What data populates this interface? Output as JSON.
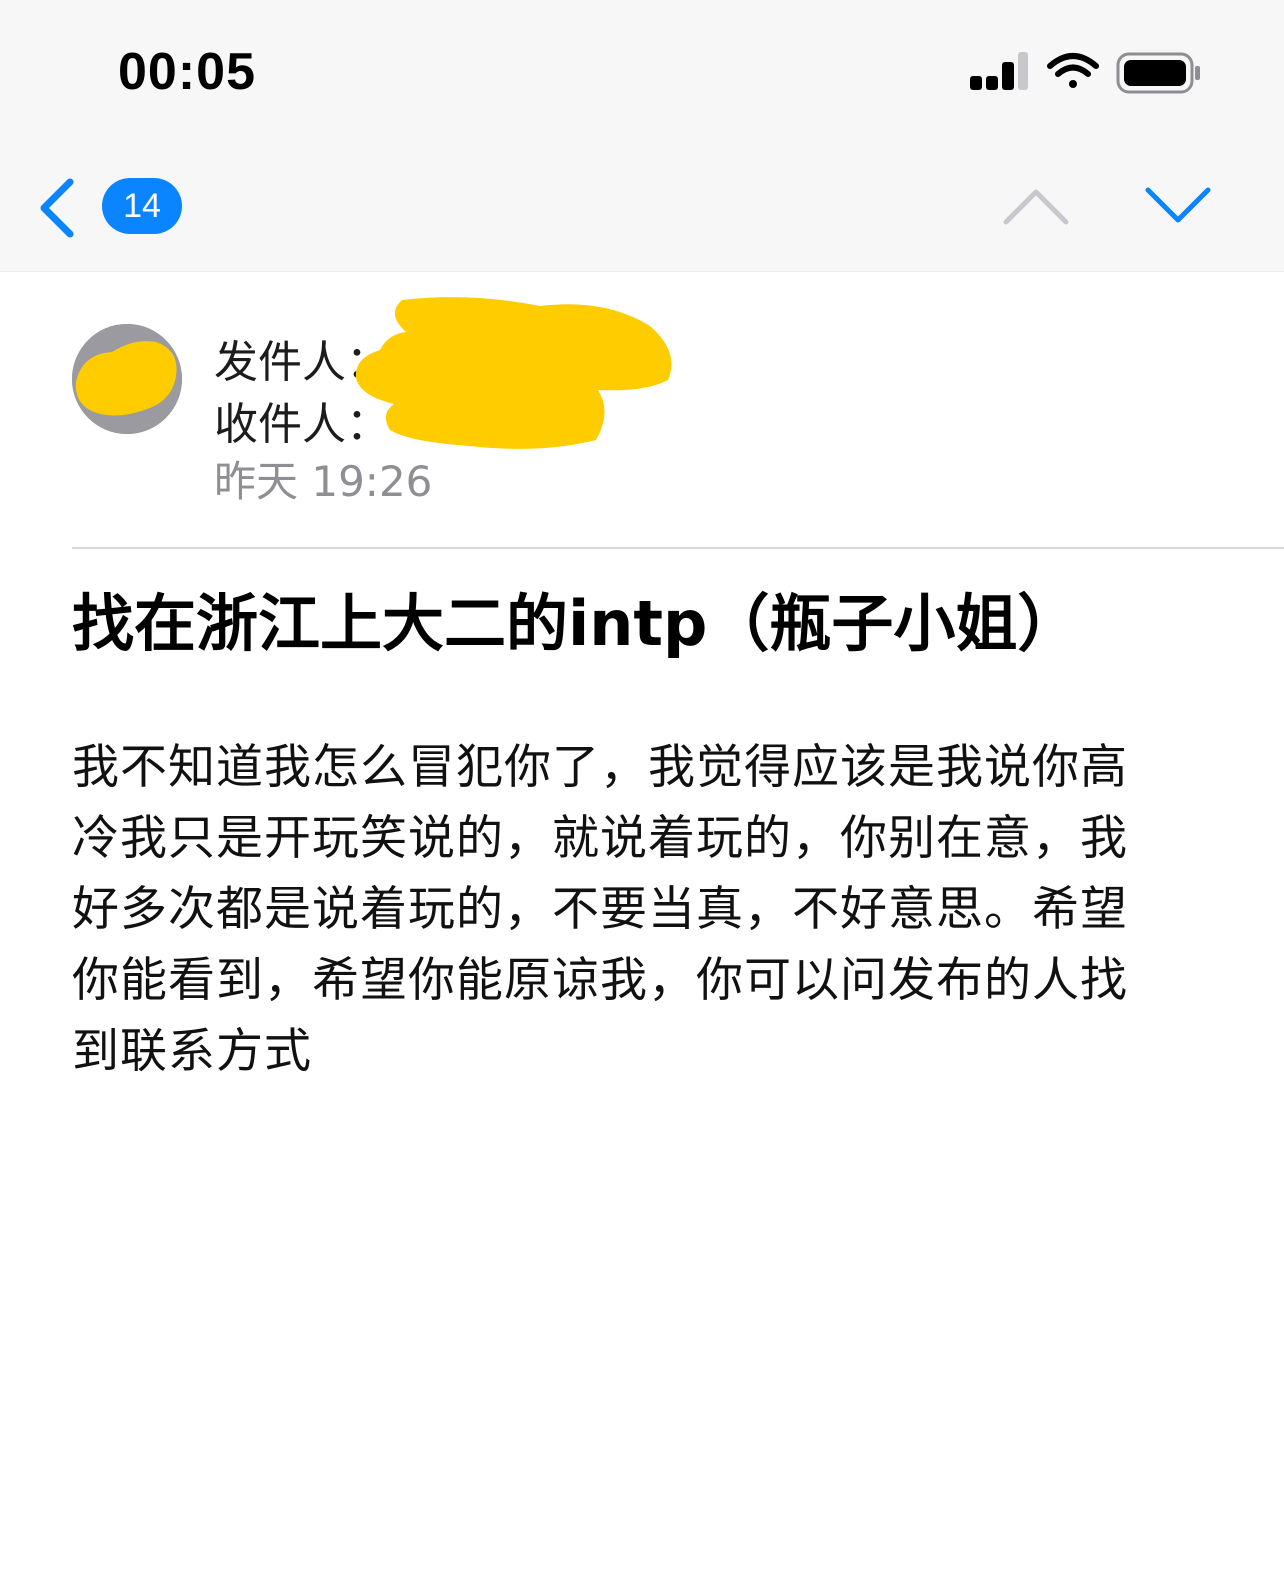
{
  "status_bar": {
    "time": "00:05",
    "icons": [
      "cellular-signal-icon",
      "wifi-icon",
      "battery-icon"
    ]
  },
  "nav": {
    "back_icon": "chevron-left-icon",
    "unread_count": "14",
    "prev_icon": "chevron-up-icon",
    "next_icon": "chevron-down-icon",
    "accent_color": "#0a84ff",
    "disabled_color": "#c7c7cc"
  },
  "header": {
    "from_label": "发件人：",
    "to_label": "收件人：",
    "date": "昨天 19:26",
    "redaction_color": "#ffcc00"
  },
  "message": {
    "subject": "找在浙江上大二的intp（瓶子小姐）",
    "body": "我不知道我怎么冒犯你了，我觉得应该是我说你高冷我只是开玩笑说的，就说着玩的，你别在意，我好多次都是说着玩的，不要当真，不好意思。希望你能看到，希望你能原谅我，你可以问发布的人找到联系方式"
  }
}
